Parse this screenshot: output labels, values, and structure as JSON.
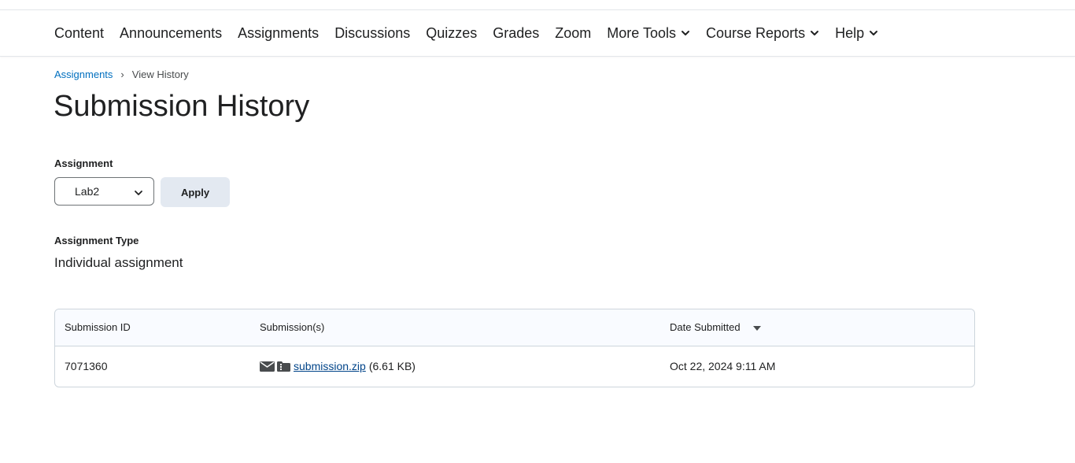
{
  "nav": {
    "items": [
      {
        "label": "Content"
      },
      {
        "label": "Announcements"
      },
      {
        "label": "Assignments"
      },
      {
        "label": "Discussions"
      },
      {
        "label": "Quizzes"
      },
      {
        "label": "Grades"
      },
      {
        "label": "Zoom"
      },
      {
        "label": "More Tools",
        "icon": "chevron-down-icon"
      },
      {
        "label": "Course Reports",
        "icon": "chevron-down-icon"
      },
      {
        "label": "Help",
        "icon": "chevron-down-icon"
      }
    ]
  },
  "breadcrumb": {
    "parent": "Assignments",
    "separator": "›",
    "current": "View History"
  },
  "page": {
    "title": "Submission History"
  },
  "assignment_filter": {
    "label": "Assignment",
    "selected": "Lab2",
    "apply_label": "Apply"
  },
  "assignment_type": {
    "label": "Assignment Type",
    "value": "Individual assignment"
  },
  "table": {
    "headers": {
      "submission_id": "Submission ID",
      "submissions": "Submission(s)",
      "date_submitted": "Date Submitted"
    },
    "sort_icon": "caret-down-icon",
    "rows": [
      {
        "submission_id": "7071360",
        "file_name": "submission.zip",
        "file_size": "(6.61 KB)",
        "date": "Oct 22, 2024 9:11 AM",
        "icons": [
          "envelope-icon",
          "zip-file-icon"
        ]
      }
    ]
  },
  "colors": {
    "link": "#006fbf",
    "file_link": "#004489",
    "button_bg": "#e3e9f1",
    "table_header_bg": "#f9fbff",
    "border": "#cdd5dc"
  }
}
